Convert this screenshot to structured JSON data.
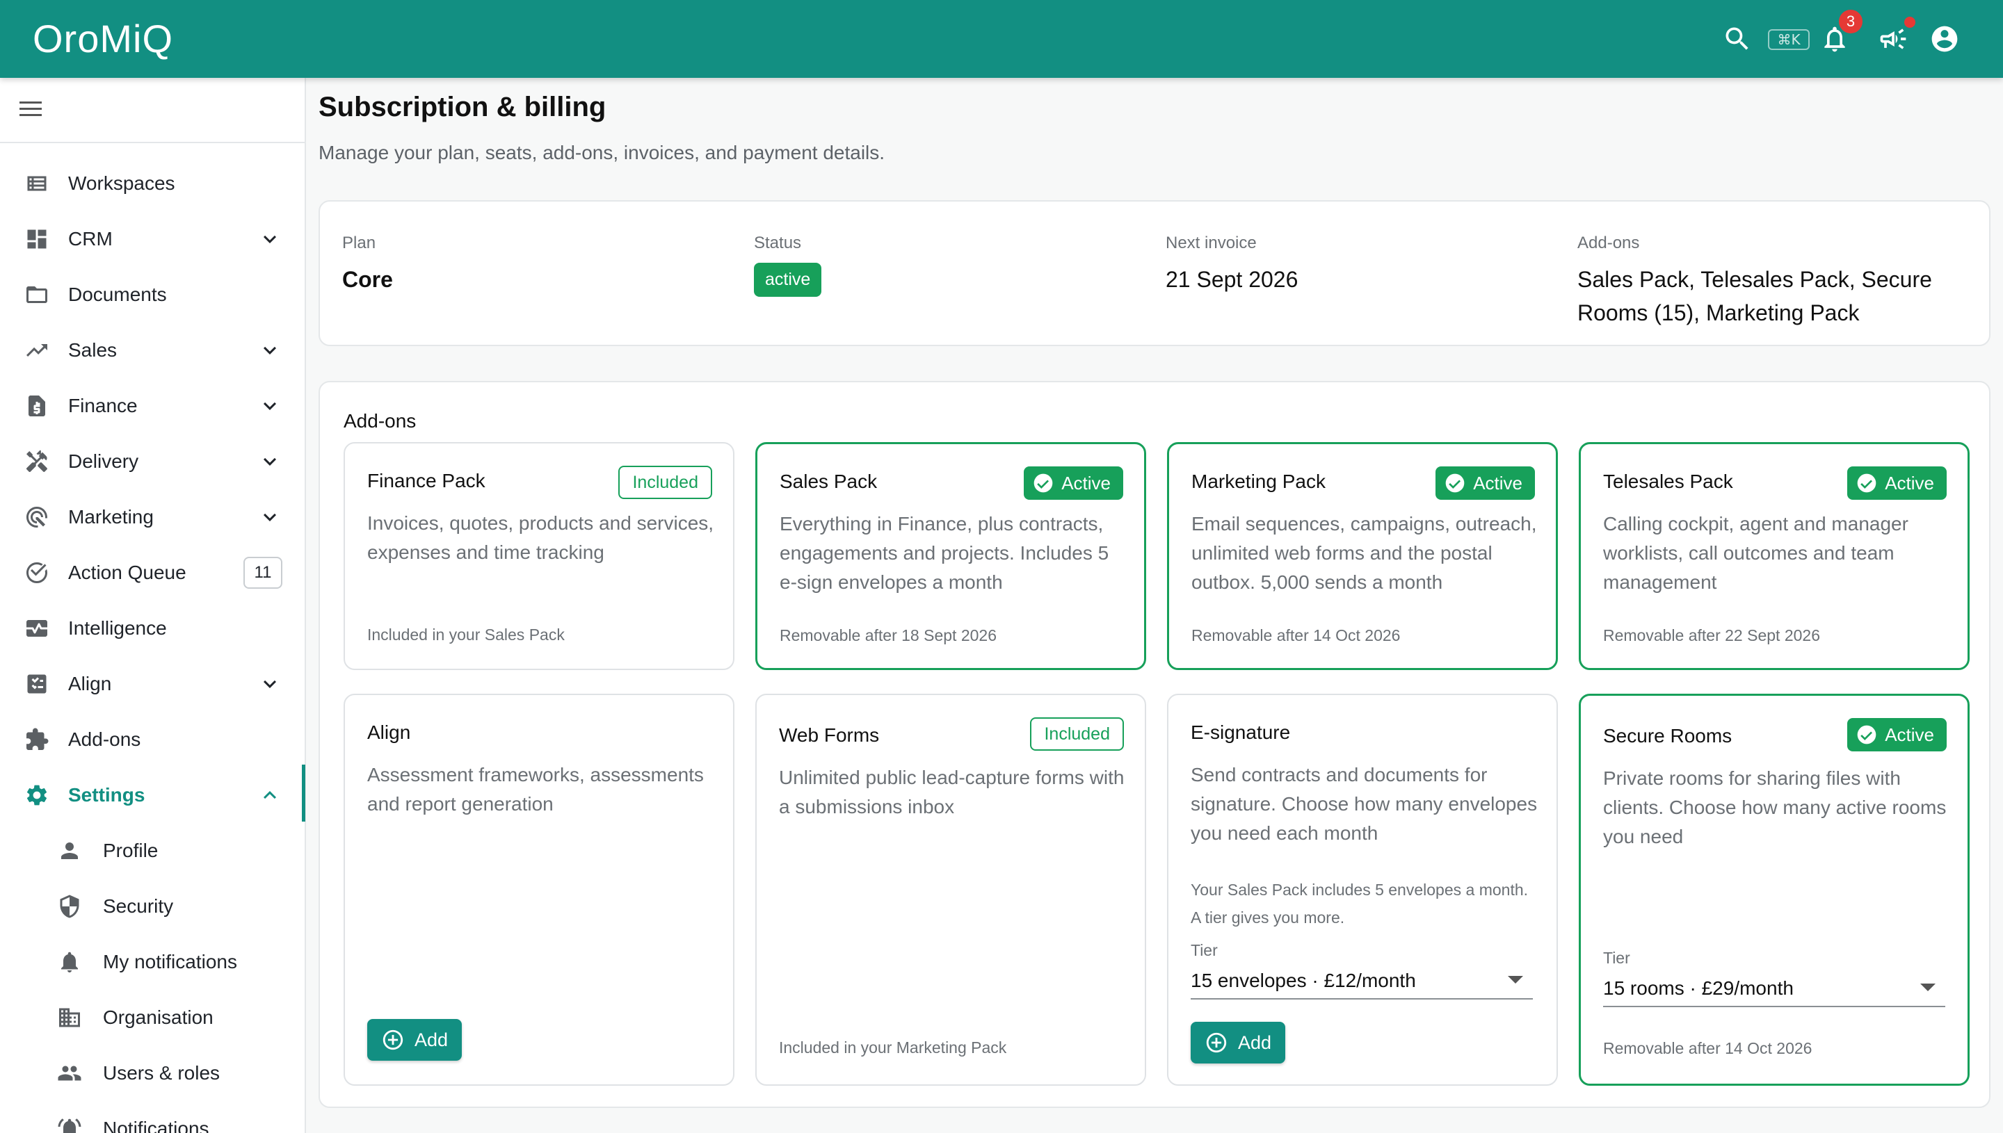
{
  "app": {
    "brand": "OroMiQ"
  },
  "topbar": {
    "shortcut": "⌘K",
    "notifications_count": "3",
    "icons": [
      "search-icon",
      "bell-icon",
      "megaphone-icon",
      "account-icon"
    ]
  },
  "sidebar": {
    "items": [
      {
        "label": "Workspaces",
        "icon": "dashboard-icon"
      },
      {
        "label": "CRM",
        "icon": "grid-icon",
        "expandable": true
      },
      {
        "label": "Documents",
        "icon": "folder-icon"
      },
      {
        "label": "Sales",
        "icon": "trending-up-icon",
        "expandable": true
      },
      {
        "label": "Finance",
        "icon": "invoice-icon",
        "expandable": true
      },
      {
        "label": "Delivery",
        "icon": "tools-icon",
        "expandable": true
      },
      {
        "label": "Marketing",
        "icon": "target-icon",
        "expandable": true
      },
      {
        "label": "Action Queue",
        "icon": "check-circle-icon",
        "count": "11"
      },
      {
        "label": "Intelligence",
        "icon": "monitor-heart-icon"
      },
      {
        "label": "Align",
        "icon": "checklist-icon",
        "expandable": true
      },
      {
        "label": "Add-ons",
        "icon": "puzzle-icon"
      },
      {
        "label": "Settings",
        "icon": "gear-icon",
        "expanded": true
      }
    ],
    "sub_items": [
      {
        "label": "Profile",
        "icon": "person-icon"
      },
      {
        "label": "Security",
        "icon": "shield-icon"
      },
      {
        "label": "My notifications",
        "icon": "bell-icon"
      },
      {
        "label": "Organisation",
        "icon": "building-icon"
      },
      {
        "label": "Users & roles",
        "icon": "people-icon"
      },
      {
        "label": "Notifications",
        "icon": "alarm-icon"
      }
    ]
  },
  "page": {
    "title": "Subscription & billing",
    "subtitle": "Manage your plan, seats, add-ons, invoices, and payment details."
  },
  "summary": {
    "plan_label": "Plan",
    "plan_value": "Core",
    "status_label": "Status",
    "status_value": "active",
    "next_invoice_label": "Next invoice",
    "next_invoice_value": "21 Sept 2026",
    "addons_label": "Add-ons",
    "addons_value": "Sales Pack, Telesales Pack, Secure Rooms (15), Marketing Pack"
  },
  "addons": {
    "title": "Add-ons",
    "cards": [
      {
        "name": "Finance Pack",
        "chip": "Included",
        "desc": "Invoices, quotes, products and services, expenses and time tracking",
        "note": "Included in your Sales Pack"
      },
      {
        "name": "Sales Pack",
        "chip": "Active",
        "desc": "Everything in Finance, plus contracts, engagements and projects. Includes 5 e-sign envelopes a month",
        "note": "Removable after 18 Sept 2026"
      },
      {
        "name": "Marketing Pack",
        "chip": "Active",
        "desc": "Email sequences, campaigns, outreach, unlimited web forms and the postal outbox. 5,000 sends a month",
        "note": "Removable after 14 Oct 2026"
      },
      {
        "name": "Telesales Pack",
        "chip": "Active",
        "desc": "Calling cockpit, agent and manager worklists, call outcomes and team management",
        "note": "Removable after 22 Sept 2026"
      },
      {
        "name": "Align",
        "desc": "Assessment frameworks, assessments and report generation",
        "button": "Add"
      },
      {
        "name": "Web Forms",
        "chip": "Included",
        "desc": "Unlimited public lead-capture forms with a submissions inbox",
        "note": "Included in your Marketing Pack"
      },
      {
        "name": "E-signature",
        "desc": "Send contracts and documents for signature. Choose how many envelopes you need each month",
        "info": "Your Sales Pack includes 5 envelopes a month. A tier gives you more.",
        "tier_label": "Tier",
        "tier_value": "15 envelopes · £12/month",
        "button": "Add"
      },
      {
        "name": "Secure Rooms",
        "chip": "Active",
        "desc": "Private rooms for sharing files with clients. Choose how many active rooms you need",
        "tier_label": "Tier",
        "tier_value": "15 rooms · £29/month",
        "note": "Removable after 14 Oct 2026"
      }
    ]
  },
  "colors": {
    "brand": "#128f82",
    "success": "#17a05a",
    "badge": "#e53935"
  }
}
